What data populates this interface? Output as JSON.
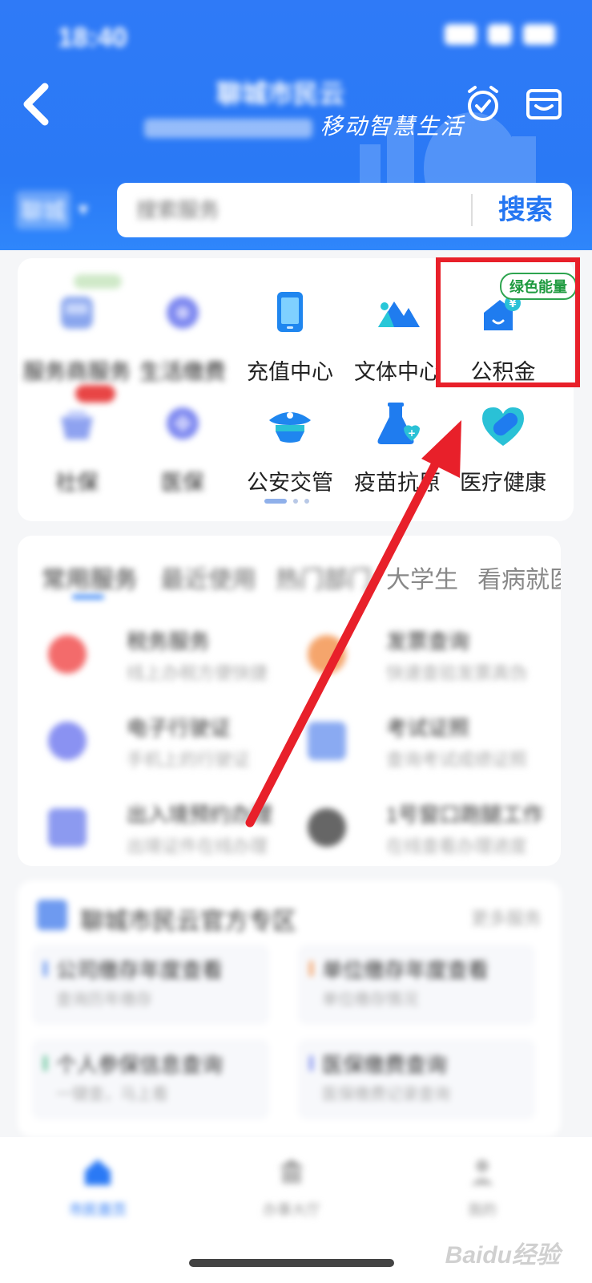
{
  "status_bar": {
    "time": "18:40"
  },
  "header": {
    "app_title": "聊城市民云",
    "slogan": "移动智慧生活",
    "city": "聊城",
    "search_placeholder": "搜索服务",
    "search_button": "搜索"
  },
  "services": {
    "items": [
      {
        "label": "服务商服务",
        "icon": "bus-icon",
        "blurred": true
      },
      {
        "label": "生活缴费",
        "icon": "bill-icon",
        "blurred": true
      },
      {
        "label": "充值中心",
        "icon": "phone-icon",
        "blurred": false
      },
      {
        "label": "文体中心",
        "icon": "mountain-icon",
        "blurred": false
      },
      {
        "label": "公积金",
        "icon": "house-fund-icon",
        "blurred": false,
        "badge": "绿色能量"
      },
      {
        "label": "社保",
        "icon": "basket-icon",
        "blurred": true
      },
      {
        "label": "医保",
        "icon": "medical-insurance-icon",
        "blurred": true
      },
      {
        "label": "公安交管",
        "icon": "police-cap-icon",
        "blurred": false
      },
      {
        "label": "疫苗抗原",
        "icon": "flask-heart-icon",
        "blurred": false
      },
      {
        "label": "医疗健康",
        "icon": "heart-pill-icon",
        "blurred": false
      }
    ]
  },
  "tabs": {
    "items": [
      {
        "label": "常用服务"
      },
      {
        "label": "最近使用"
      },
      {
        "label": "热门部门"
      },
      {
        "label": "大学生"
      },
      {
        "label": "看病就医"
      }
    ],
    "quick_items": [
      {
        "title": "税务服务",
        "sub": "线上办税方便快捷",
        "color": "#f36b6b"
      },
      {
        "title": "发票查询",
        "sub": "快速查验发票真伪",
        "color": "#f5a56c"
      },
      {
        "title": "电子行驶证",
        "sub": "手机上的行驶证",
        "color": "#8a92f2"
      },
      {
        "title": "考试证照",
        "sub": "查询考试成绩证照",
        "color": "#8aaaf2"
      },
      {
        "title": "出入境预约办理",
        "sub": "出境证件在线办理",
        "color": "#8c9af0"
      },
      {
        "title": "1号窗口跑腿工作",
        "sub": "在线查看办理进度",
        "color": "#666666"
      }
    ]
  },
  "zone": {
    "title": "聊城市民云官方专区",
    "more": "更多服务",
    "items": [
      {
        "title": "公司缴存年度查看",
        "sub": "查询历年缴存",
        "accent": "#6e9af0"
      },
      {
        "title": "单位缴存年度查看",
        "sub": "单位缴存情况",
        "accent": "#f5a56c"
      },
      {
        "title": "个人参保信息查询",
        "sub": "一键查，马上看",
        "accent": "#6ec7a0"
      },
      {
        "title": "医保缴费查询",
        "sub": "医保缴费记录查询",
        "accent": "#8c9af0"
      }
    ]
  },
  "bottom_nav": {
    "items": [
      {
        "label": "市民首页",
        "active": true
      },
      {
        "label": "办事大厅",
        "active": false
      },
      {
        "label": "我的",
        "active": false
      }
    ]
  },
  "watermark": "Baidu经验",
  "colors": {
    "brand": "#2a79f5",
    "highlight": "#e8202a",
    "energy_badge": "#1e9a3f"
  }
}
